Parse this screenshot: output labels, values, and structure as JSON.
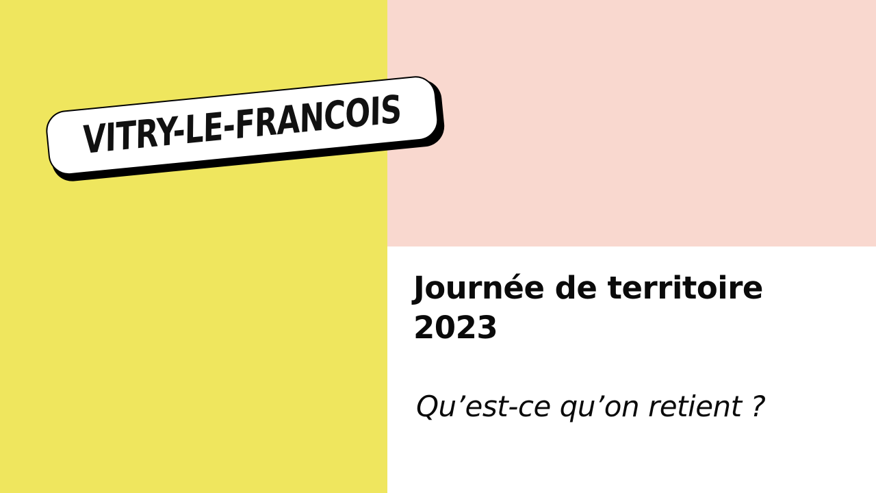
{
  "colors": {
    "yellow": "#efe65e",
    "pink": "#f9d8cf"
  },
  "badge": {
    "label": "VITRY-LE-FRANCOIS"
  },
  "title": {
    "line1": "Journée de territoire",
    "line2": "2023"
  },
  "subtitle": "Qu’est-ce qu’on retient ?"
}
